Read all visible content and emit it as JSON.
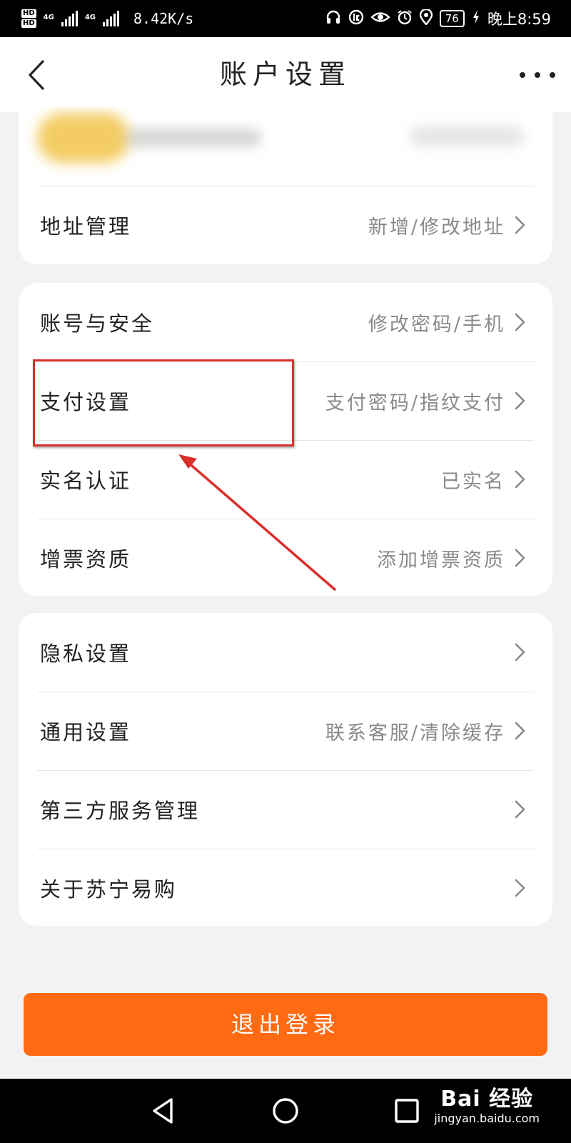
{
  "status_bar": {
    "hd1": "HD",
    "hd2": "HD",
    "net1": "4G",
    "net2": "4G",
    "speed": "8.42K/s",
    "battery": "76",
    "time": "晚上8:59",
    "icons": [
      "headset-icon",
      "signal-1k-icon",
      "eye-icon",
      "alarm-icon",
      "location-icon",
      "charging-icon"
    ]
  },
  "header": {
    "title": "账户设置",
    "back_icon": "chevron-left-icon",
    "more_icon": "more-dots-icon"
  },
  "sections": [
    {
      "items": [
        {
          "label": "地址管理",
          "value": "新增/修改地址"
        }
      ]
    },
    {
      "items": [
        {
          "label": "账号与安全",
          "value": "修改密码/手机"
        },
        {
          "label": "支付设置",
          "value": "支付密码/指纹支付"
        },
        {
          "label": "实名认证",
          "value": "已实名"
        },
        {
          "label": "增票资质",
          "value": "添加增票资质"
        }
      ]
    },
    {
      "items": [
        {
          "label": "隐私设置",
          "value": ""
        },
        {
          "label": "通用设置",
          "value": "联系客服/清除缓存"
        },
        {
          "label": "第三方服务管理",
          "value": ""
        },
        {
          "label": "关于苏宁易购",
          "value": ""
        }
      ]
    }
  ],
  "logout": {
    "label": "退出登录"
  },
  "watermark": {
    "logo": "Bai  经验",
    "url": "jingyan.baidu.com"
  },
  "colors": {
    "accent": "#ff6a12",
    "highlight": "#d9302c",
    "background": "#f2f2f2"
  }
}
